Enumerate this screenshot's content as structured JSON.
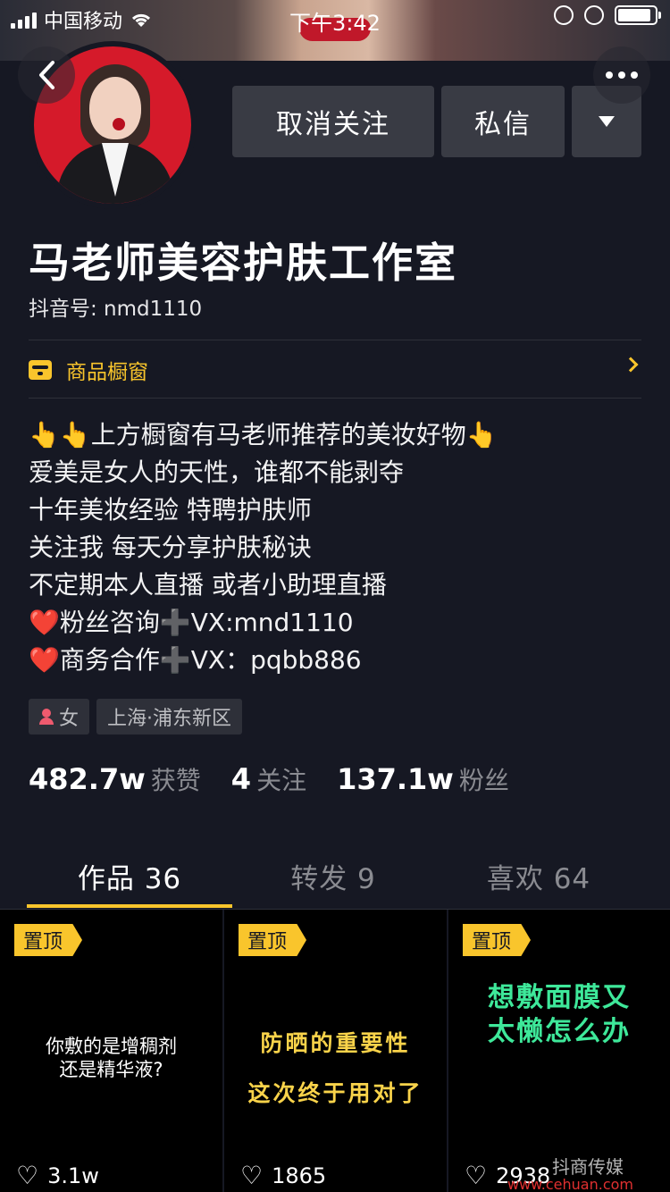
{
  "status_bar": {
    "carrier": "中国移动",
    "time": "下午3:42"
  },
  "profile": {
    "name": "马老师美容护肤工作室",
    "douyin_id": "抖音号: nmd1110",
    "avatar_bg": "#d51a2a"
  },
  "actions": {
    "unfollow": "取消关注",
    "message": "私信"
  },
  "shop": {
    "label": "商品橱窗",
    "accent": "#f9c52c"
  },
  "bio": [
    "👆👆上方橱窗有马老师推荐的美妆好物👆",
    "爱美是女人的天性，谁都不能剥夺",
    "十年美妆经验 特聘护肤师",
    "关注我 每天分享护肤秘诀",
    "不定期本人直播 或者小助理直播",
    "❤️粉丝咨询➕VX:mnd1110",
    "❤️商务合作➕VX：pqbb886"
  ],
  "tags": {
    "gender": "女",
    "location": "上海·浦东新区"
  },
  "stats": [
    {
      "value": "482.7w",
      "label": "获赞"
    },
    {
      "value": "4",
      "label": "关注"
    },
    {
      "value": "137.1w",
      "label": "粉丝"
    }
  ],
  "tabs": [
    {
      "label": "作品 36",
      "active": true
    },
    {
      "label": "转发 9",
      "active": false
    },
    {
      "label": "喜欢 64",
      "active": false
    }
  ],
  "videos": [
    {
      "pin": "置顶",
      "lines": [
        "你敷的是增稠剂",
        "还是精华液?"
      ],
      "likes": "3.1w",
      "text_color": "#ffffff"
    },
    {
      "pin": "置顶",
      "lines": [
        "防晒的重要性",
        "这次终于用对了"
      ],
      "likes": "1865",
      "text_color": "#f9d34a"
    },
    {
      "pin": "置顶",
      "lines": [
        "想敷面膜又",
        "太懒怎么办"
      ],
      "likes": "2938",
      "text_color": "#3ee89a"
    }
  ],
  "watermark": {
    "text": "抖商传媒",
    "url": "www.cehuan.com"
  }
}
